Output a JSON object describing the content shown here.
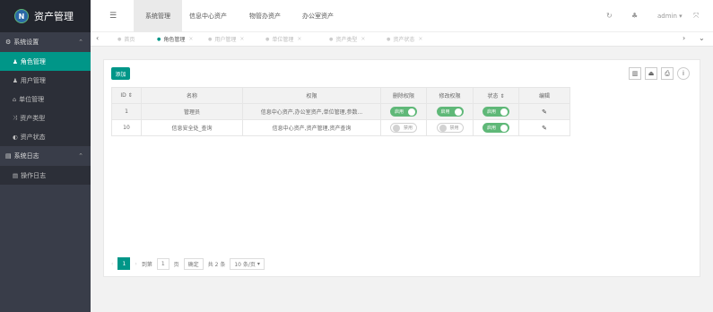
{
  "app": {
    "logo_letter": "N",
    "title": "资产管理"
  },
  "sidebar": {
    "groups": [
      {
        "label": "系统设置",
        "icon": "gears-icon",
        "items": [
          {
            "label": "角色管理",
            "icon": "user-icon",
            "active": true
          },
          {
            "label": "用户管理",
            "icon": "user-icon"
          },
          {
            "label": "单位管理",
            "icon": "bank-icon"
          },
          {
            "label": "资产类型",
            "icon": "shuffle-icon"
          },
          {
            "label": "资产状态",
            "icon": "status-icon"
          }
        ]
      },
      {
        "label": "系统日志",
        "icon": "file-icon",
        "items": [
          {
            "label": "操作日志",
            "icon": "file-icon"
          }
        ]
      }
    ]
  },
  "header": {
    "tabs": [
      "系统管理",
      "信息中心资产",
      "物管办资产",
      "办公室资产"
    ],
    "active_tab": "系统管理",
    "user": "admin"
  },
  "pagetabs": [
    "首页",
    "角色管理",
    "用户管理",
    "单位管理",
    "资产类型",
    "资产状态"
  ],
  "toolbar": {
    "add_label": "添加"
  },
  "table": {
    "headers": [
      "ID",
      "名称",
      "权限",
      "删除权限",
      "修改权限",
      "状态",
      "编辑"
    ],
    "rows": [
      {
        "id": "1",
        "name": "管理员",
        "perm": "信息中心资产,办公室资产,单位管理,参数...",
        "del": "启用",
        "mod": "启用",
        "status": "启用"
      },
      {
        "id": "10",
        "name": "信息安全处_查询",
        "perm": "信息中心资产,资产管理,资产查询",
        "del": "禁用",
        "mod": "禁用",
        "status": "启用"
      }
    ]
  },
  "pager": {
    "current": "1",
    "goto_label": "到第",
    "page_input": "1",
    "page_unit": "页",
    "confirm": "确定",
    "total": "共 2 条",
    "per_page": "10 条/页"
  },
  "colors": {
    "accent": "#009688",
    "switch_on": "#5fb878",
    "sidebar": "#393d49"
  }
}
